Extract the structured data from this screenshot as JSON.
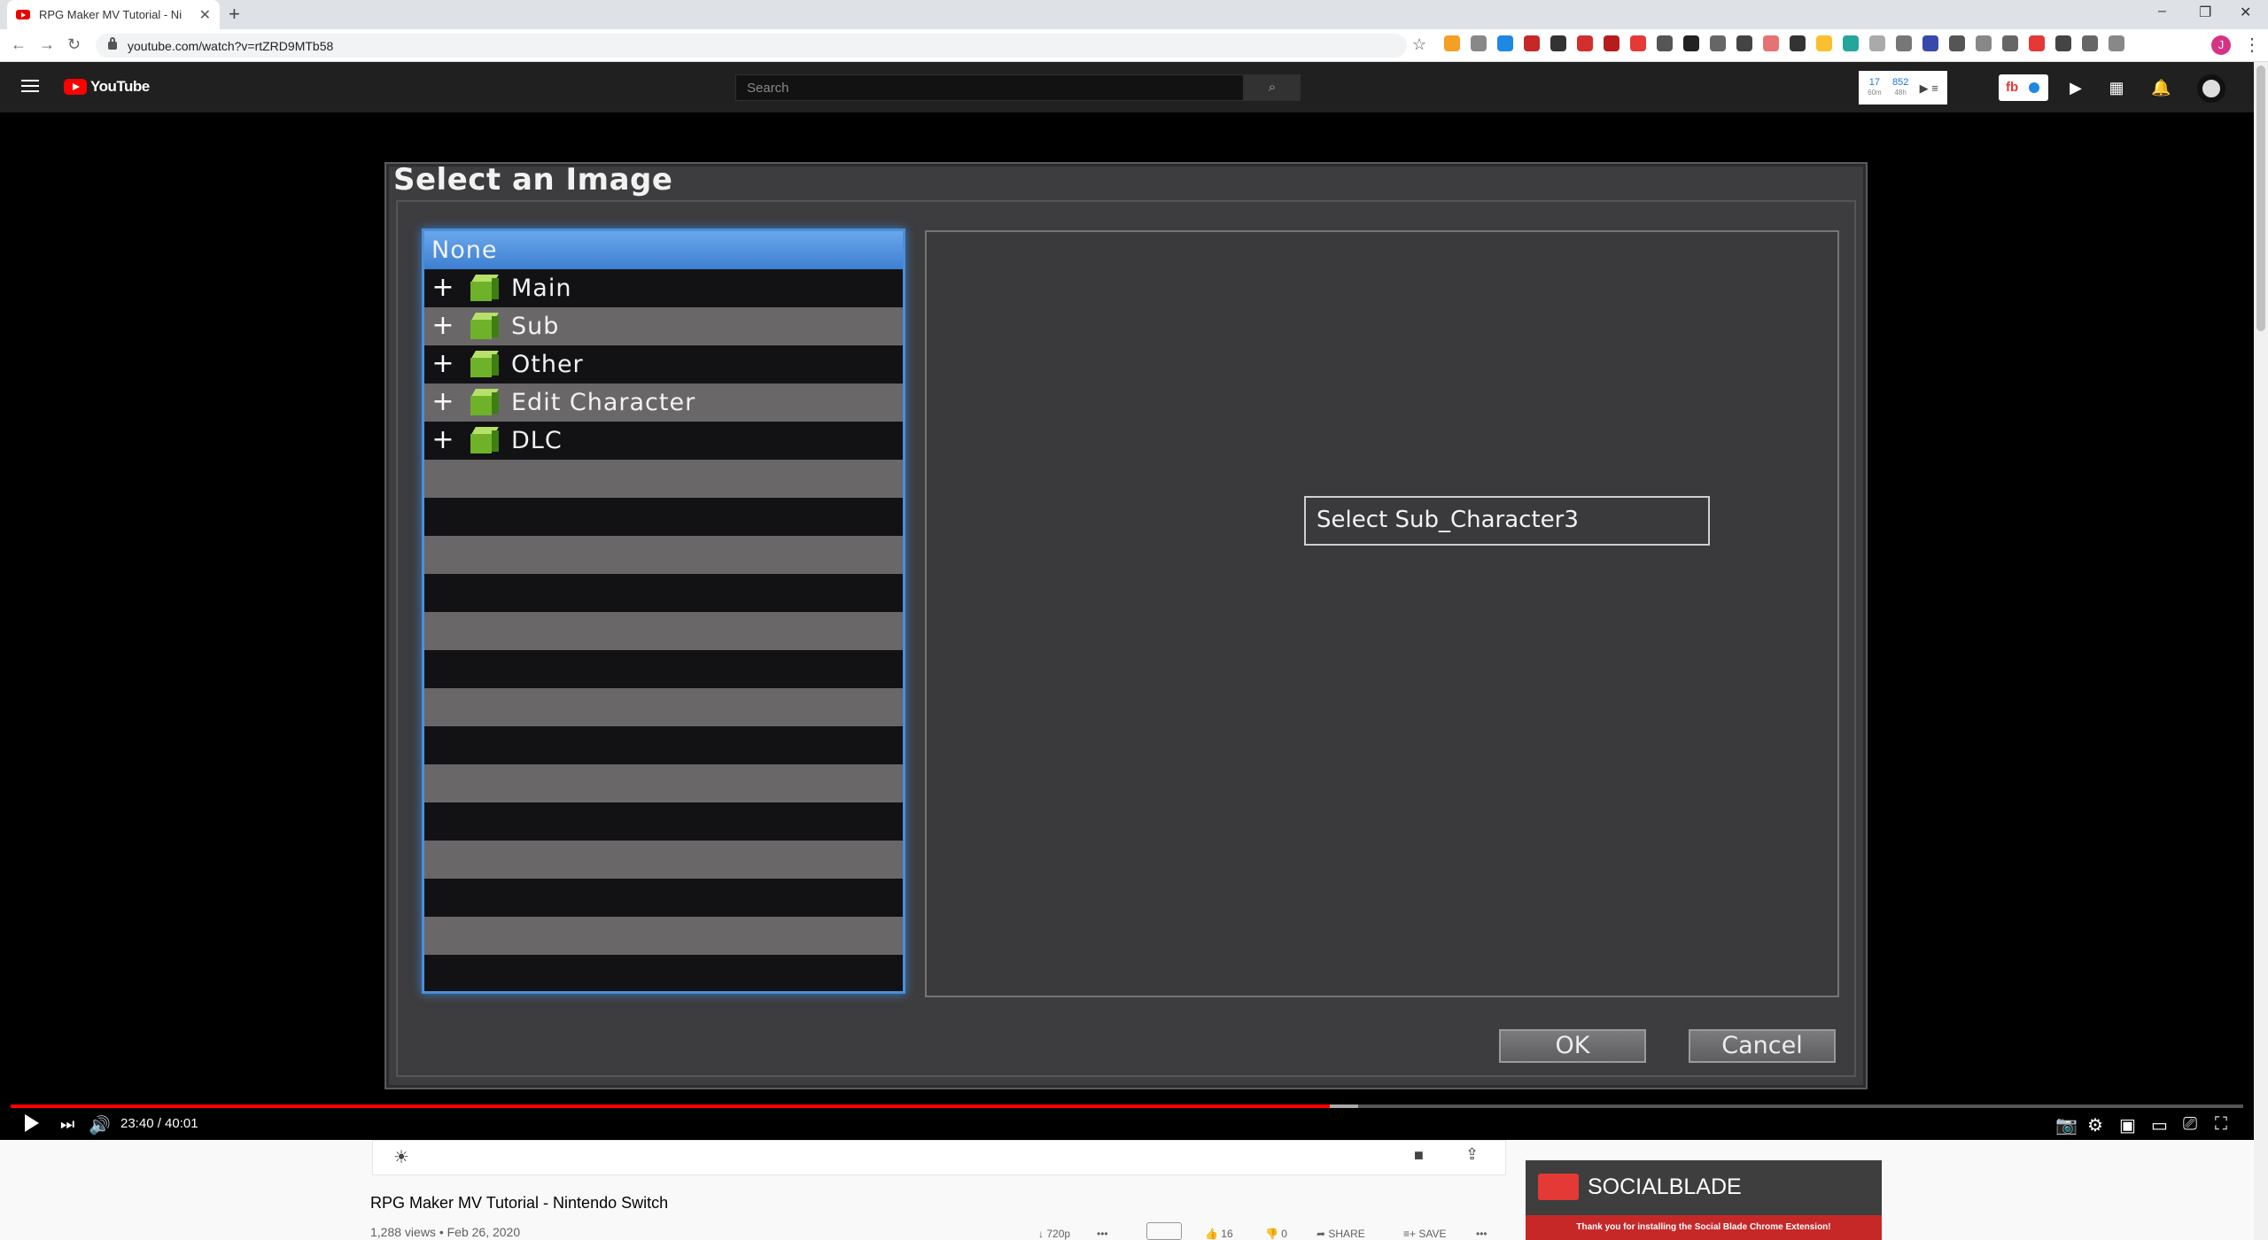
{
  "browser": {
    "tab_title": "RPG Maker MV Tutorial - Ni",
    "url": "youtube.com/watch?v=rtZRD9MTb58",
    "profile_initial": "J"
  },
  "youtube": {
    "logo_text": "YouTube",
    "search_placeholder": "Search",
    "sb_widget": {
      "stat1": "17",
      "stat1_label": "60m",
      "stat2": "852",
      "stat2_label": "48h"
    },
    "fb_widget_label": "fb"
  },
  "dialog": {
    "title": "Select an Image",
    "tree_items": [
      {
        "label": "None",
        "selected": true,
        "expandable": false
      },
      {
        "label": "Main",
        "selected": false,
        "expandable": true
      },
      {
        "label": "Sub",
        "selected": false,
        "expandable": true
      },
      {
        "label": "Other",
        "selected": false,
        "expandable": true
      },
      {
        "label": "Edit Character",
        "selected": false,
        "expandable": true
      },
      {
        "label": "DLC",
        "selected": false,
        "expandable": true
      }
    ],
    "tooltip": "Select Sub_Character3",
    "ok_label": "OK",
    "cancel_label": "Cancel"
  },
  "player": {
    "time": "23:40 / 40:01",
    "progress_fraction": 0.591
  },
  "video": {
    "title": "RPG Maker MV Tutorial - Nintendo Switch",
    "stats": "1,288 views • Feb 26, 2020",
    "quality": "720p",
    "likes": "16",
    "dislikes": "0",
    "share_label": "SHARE",
    "save_label": "SAVE"
  },
  "socialblade": {
    "brand": "SOCIALBLADE",
    "message": "Thank you for installing the Social Blade Chrome Extension!"
  },
  "colors": {
    "selection_blue": "#4a8fd9",
    "youtube_red": "#ff0000",
    "folder_green": "#6fb22a"
  }
}
